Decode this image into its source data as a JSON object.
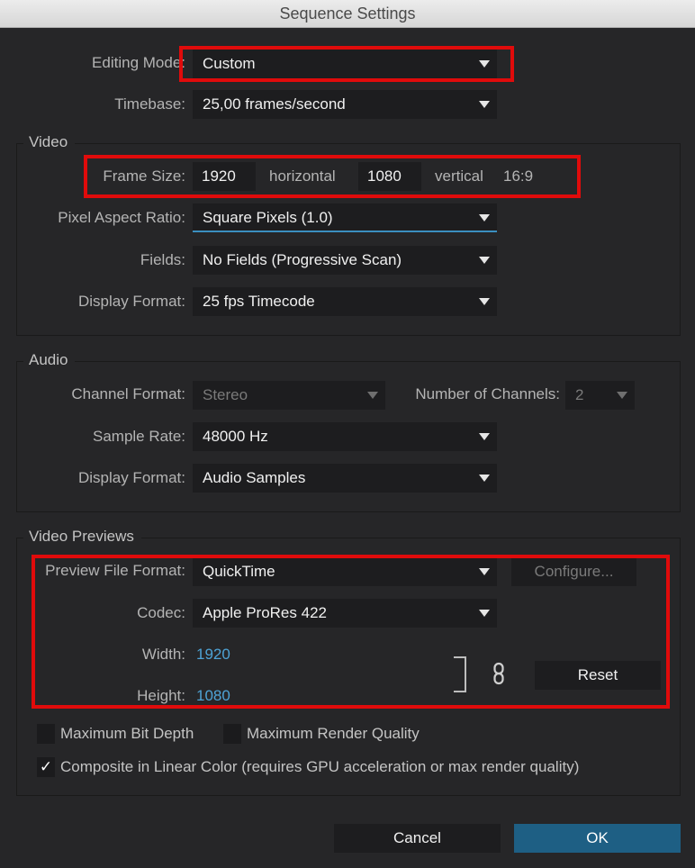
{
  "window": {
    "title": "Sequence Settings"
  },
  "general": {
    "editing_mode": {
      "label": "Editing Mode:",
      "value": "Custom"
    },
    "timebase": {
      "label": "Timebase:",
      "value": "25,00  frames/second"
    }
  },
  "video": {
    "title": "Video",
    "frame_size": {
      "label": "Frame Size:",
      "horizontal_value": "1920",
      "horizontal_label": "horizontal",
      "vertical_value": "1080",
      "vertical_label": "vertical",
      "aspect": "16:9"
    },
    "pixel_aspect_ratio": {
      "label": "Pixel Aspect Ratio:",
      "value": "Square Pixels (1.0)"
    },
    "fields": {
      "label": "Fields:",
      "value": "No Fields (Progressive Scan)"
    },
    "display_format": {
      "label": "Display Format:",
      "value": "25 fps Timecode"
    }
  },
  "audio": {
    "title": "Audio",
    "channel_format": {
      "label": "Channel Format:",
      "value": "Stereo"
    },
    "number_of_channels": {
      "label": "Number of Channels:",
      "value": "2"
    },
    "sample_rate": {
      "label": "Sample Rate:",
      "value": "48000 Hz"
    },
    "display_format": {
      "label": "Display Format:",
      "value": "Audio Samples"
    }
  },
  "video_previews": {
    "title": "Video Previews",
    "preview_file_format": {
      "label": "Preview File Format:",
      "value": "QuickTime"
    },
    "configure_label": "Configure...",
    "codec": {
      "label": "Codec:",
      "value": "Apple ProRes 422"
    },
    "width": {
      "label": "Width:",
      "value": "1920"
    },
    "height": {
      "label": "Height:",
      "value": "1080"
    },
    "reset_label": "Reset",
    "link_icon": "chain-link-icon",
    "options": [
      {
        "label": "Maximum Bit Depth",
        "checked": false
      },
      {
        "label": "Maximum Render Quality",
        "checked": false
      },
      {
        "label": "Composite in Linear Color (requires GPU acceleration or max render quality)",
        "checked": true
      }
    ],
    "check_glyph": "✓"
  },
  "footer": {
    "cancel_label": "Cancel",
    "ok_label": "OK"
  },
  "colors": {
    "highlight": "#e00b0b",
    "accent": "#4ea3d6",
    "primary_button": "#1e5f84"
  }
}
